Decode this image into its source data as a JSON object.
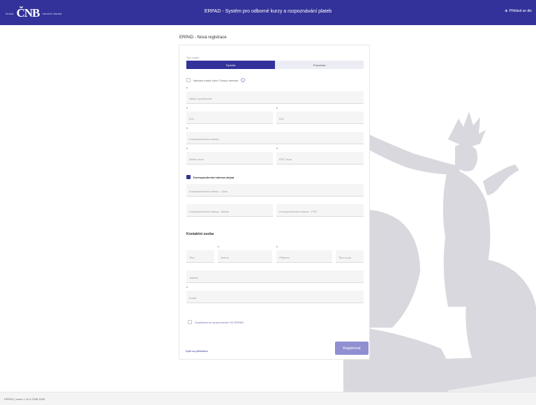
{
  "header": {
    "logo_small": "česká",
    "logo_big": "ČNB",
    "logo_tag": "národní banka",
    "title": "ERPAD - Systém pro odborné kurzy a rozpoznávání plateb",
    "lang_label": "Přihlásit se dle"
  },
  "page": {
    "heading": "ERPAD - Nová registrace"
  },
  "form": {
    "person_type_label": "Typ osoby",
    "person_types": [
      "Fyzická",
      "Právnická"
    ],
    "selected_person_type": "Fyzická",
    "no_personal_id_label": "Nemám rodné číslo / Dosud nemám",
    "fields": {
      "company_name": "Název společnosti",
      "ico": "IČO",
      "dic": "DIČ",
      "address": "Korespondenční adresa",
      "city": "Město obce",
      "zip": "PSČ obce"
    },
    "correspondence_label": "Korespondenční adresa stejná",
    "corr_fields": {
      "street": "Korespondenční adresa - Ulice",
      "city": "Korespondenční adresa - Město",
      "zip": "Korespondenční adresa - PSČ"
    },
    "contact_section": "Kontaktní osoba",
    "contact_fields": {
      "title_before": "Titul",
      "first_name": "Jméno",
      "last_name": "Příjmení",
      "title_after": "Titul za jm.",
      "phone": "Telefon",
      "email": "Email"
    },
    "gdpr_label": "Souhlasím se zpracováním OÚ ERPAD",
    "back_link": "Zpět na přihlášení",
    "register_button": "Registrovat"
  },
  "footer": {
    "version": "ERPAD | verze 1.10.0 ČNB 2025"
  },
  "colors": {
    "brand": "#33329a",
    "button": "#8f8fd1"
  }
}
